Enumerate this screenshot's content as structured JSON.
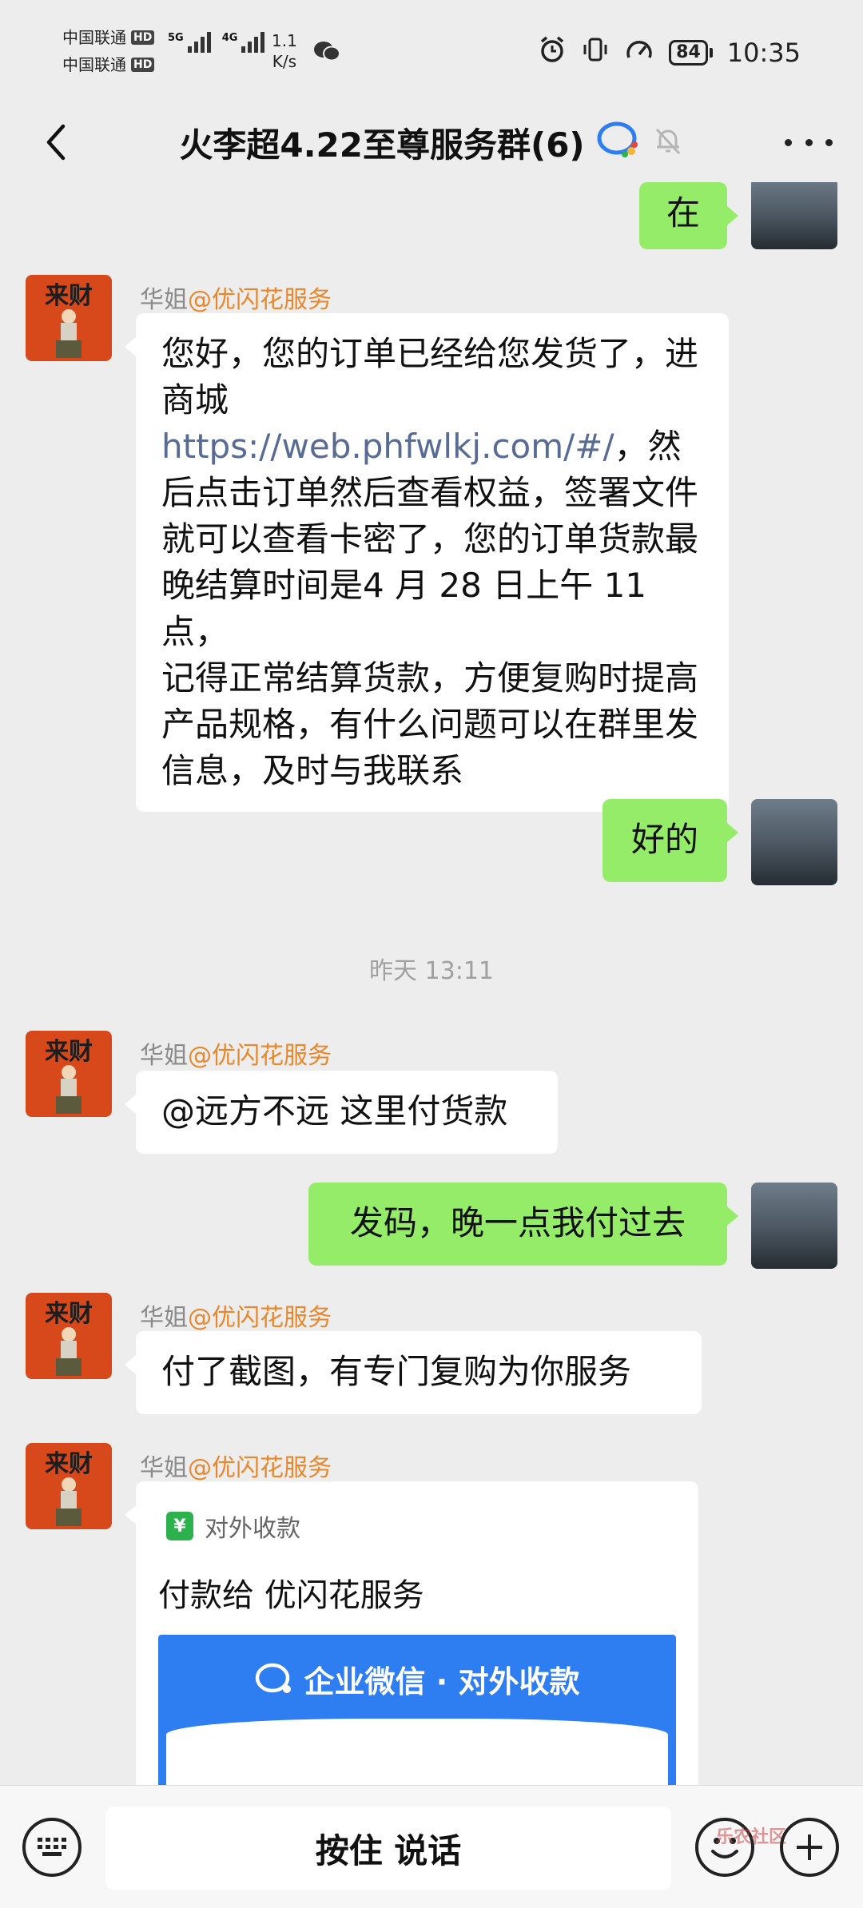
{
  "status_bar": {
    "carrier1": "中国联通",
    "carrier2": "中国联通",
    "hd_badge": "HD",
    "network1": "5G",
    "network2": "4G",
    "speed_value": "1.1",
    "speed_unit": "K/s",
    "battery": "84",
    "time": "10:35"
  },
  "nav": {
    "title": "火李超4.22至尊服务群(6)"
  },
  "messages": [
    {
      "id": "m1",
      "type": "text",
      "from": "self",
      "text": "在"
    },
    {
      "id": "m2",
      "type": "text",
      "from": "other",
      "sender": "华姐",
      "sender_tag": "@优闪花服务",
      "text_before_link": "您好，您的订单已经给您发货了，进商城 ",
      "link": "https://web.phfwlkj.com/#/",
      "text_after_link": "，然后点击订单然后查看权益，签署文件就可以查看卡密了，您的订单货款最晚结算时间是4 月 28 日上午 11 点，",
      "text_second_line": "记得正常结算货款，方便复购时提高产品规格，有什么问题可以在群里发信息，及时与我联系"
    },
    {
      "id": "m3",
      "type": "text",
      "from": "self",
      "text": "好的"
    },
    {
      "id": "t1",
      "type": "timestamp",
      "text": "昨天 13:11"
    },
    {
      "id": "m4",
      "type": "text",
      "from": "other",
      "sender": "华姐",
      "sender_tag": "@优闪花服务",
      "text": "@远方不远 这里付货款"
    },
    {
      "id": "m5",
      "type": "text",
      "from": "self",
      "text": "发码，晚一点我付过去"
    },
    {
      "id": "m6",
      "type": "text",
      "from": "other",
      "sender": "华姐",
      "sender_tag": "@优闪花服务",
      "text": "付了截图，有专门复购为你服务"
    },
    {
      "id": "m7",
      "type": "payment_card",
      "from": "other",
      "sender": "华姐",
      "sender_tag": "@优闪花服务",
      "card_header": "对外收款",
      "pay_to": "付款给 优闪花服务",
      "banner": "企业微信 · 对外收款"
    }
  ],
  "avatar_other_text": "来财",
  "input_bar": {
    "voice_label": "按住 说话",
    "watermark": "乐农社区"
  },
  "colors": {
    "background": "#ededed",
    "self_bubble": "#95ec69",
    "other_bubble": "#ffffff",
    "link": "#576b95",
    "sender_tag": "#e8872c",
    "pay_banner": "#2e7ef2",
    "pay_icon": "#2bb24c"
  }
}
